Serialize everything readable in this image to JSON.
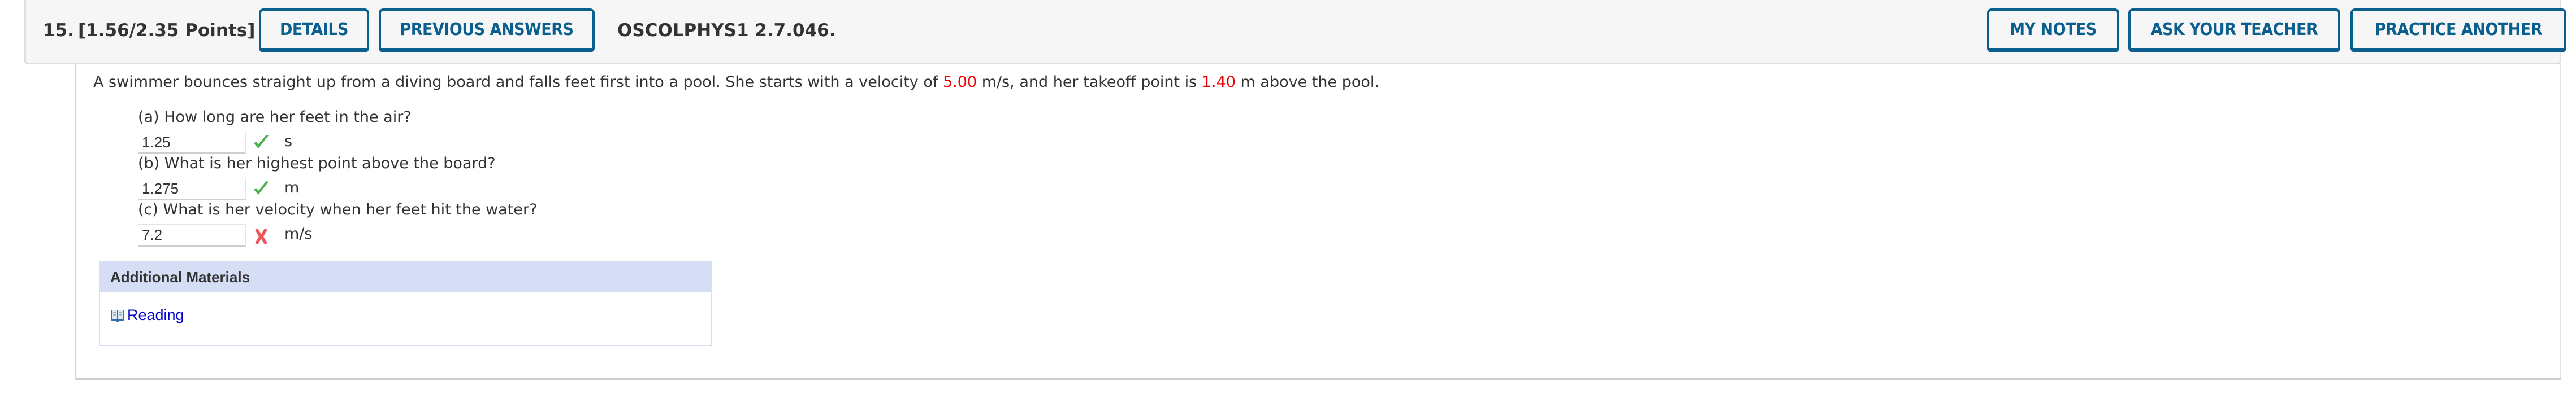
{
  "header": {
    "question_number": "15.",
    "points": "[1.56/2.35 Points]",
    "details_label": "DETAILS",
    "previous_answers_label": "PREVIOUS ANSWERS",
    "problem_code": "OSCOLPHYS1 2.7.046.",
    "my_notes_label": "MY NOTES",
    "ask_teacher_label": "ASK YOUR TEACHER",
    "practice_another_label": "PRACTICE ANOTHER"
  },
  "problem": {
    "text_1": "A swimmer bounces straight up from a diving board and falls feet first into a pool. She starts with a velocity of ",
    "velocity": "5.00",
    "text_2": " m/s, and her takeoff point is ",
    "height": "1.40",
    "text_3": " m above the pool.",
    "highlight_color": "#ee0000"
  },
  "parts": [
    {
      "label": "(a) How long are her feet in the air?",
      "value": "1.25",
      "status": "correct",
      "unit": "s"
    },
    {
      "label": "(b) What is her highest point above the board?",
      "value": "1.275",
      "status": "correct",
      "unit": "m"
    },
    {
      "label": "(c) What is her velocity when her feet hit the water?",
      "value": "7.2",
      "status": "incorrect",
      "unit": "m/s"
    }
  ],
  "additional_materials": {
    "title": "Additional Materials",
    "links": [
      {
        "label": "Reading",
        "icon": "book-icon"
      }
    ]
  },
  "colors": {
    "button": "#0a5f8e",
    "correct": "#4caf50",
    "incorrect": "#f0555a",
    "link": "#0000cc"
  }
}
